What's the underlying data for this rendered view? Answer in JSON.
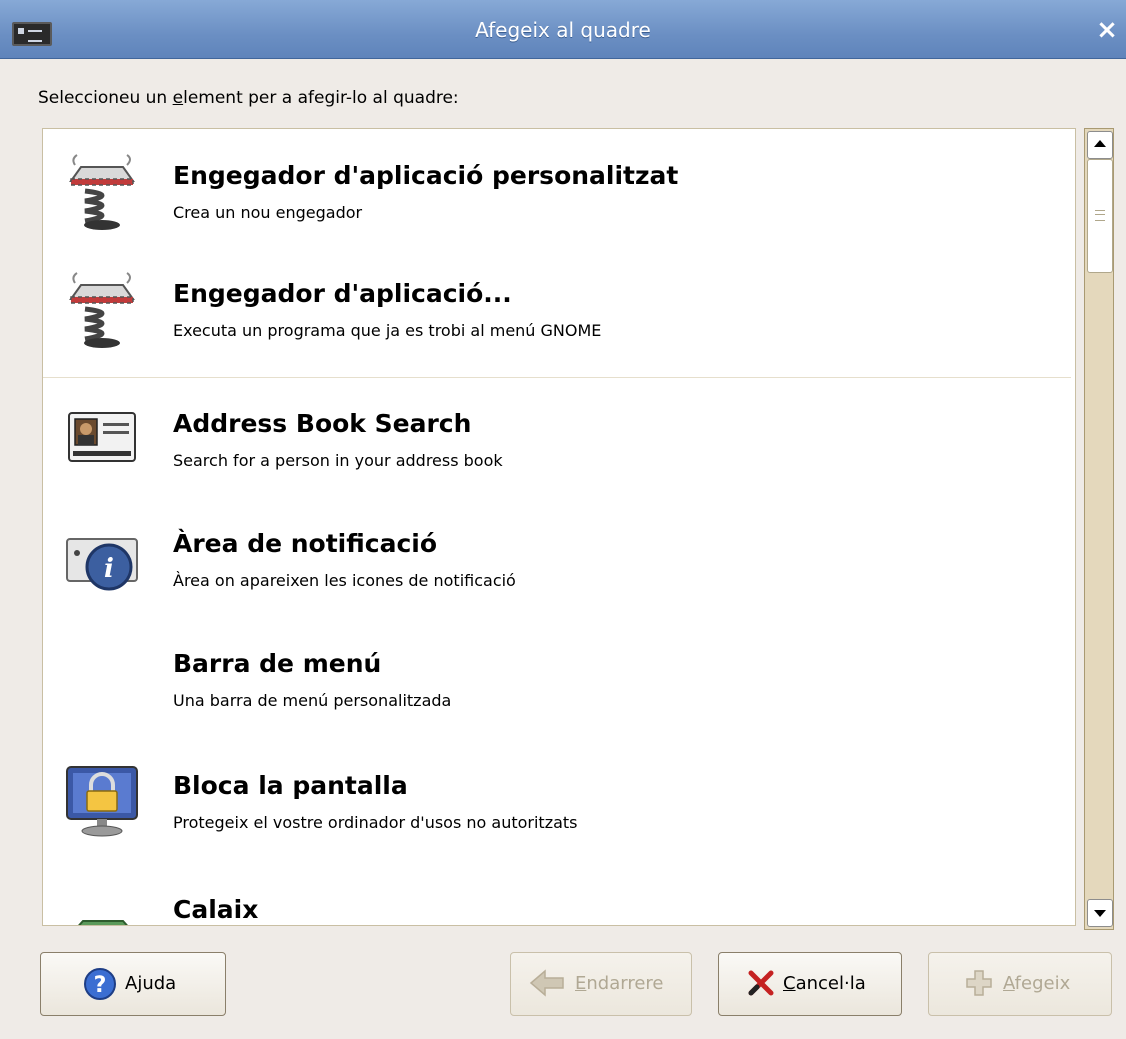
{
  "window": {
    "title": "Afegeix al quadre",
    "close_glyph": "×"
  },
  "prompt": {
    "before": "Seleccioneu un ",
    "mnemonic": "e",
    "after": "lement per a afegir-lo al quadre:"
  },
  "items": [
    {
      "name": "Engegador d'aplicació personalitzat",
      "description": "Crea un nou engegador",
      "icon": "launcher-spring-icon"
    },
    {
      "name": "Engegador d'aplicació...",
      "description": "Executa un programa que ja es trobi al menú GNOME",
      "icon": "launcher-spring-icon"
    },
    {
      "name": "Address Book Search",
      "description": "Search for a person in your address book",
      "icon": "address-card-icon"
    },
    {
      "name": "Àrea de notificació",
      "description": "Àrea on apareixen les icones de notificació",
      "icon": "notification-area-icon"
    },
    {
      "name": "Barra de menú",
      "description": "Una barra de menú personalitzada",
      "icon": ""
    },
    {
      "name": "Bloca la pantalla",
      "description": "Protegeix el vostre ordinador d'usos no autoritzats",
      "icon": "lock-screen-icon"
    },
    {
      "name": "Calaix",
      "description": "",
      "icon": "drawer-icon"
    }
  ],
  "buttons": {
    "help": {
      "before": "A",
      "mnemonic": "j",
      "after": "uda"
    },
    "back": {
      "before": "",
      "mnemonic": "E",
      "after": "ndarrere"
    },
    "cancel": {
      "before": "",
      "mnemonic": "C",
      "after": "ancel·la"
    },
    "add": {
      "before": "",
      "mnemonic": "A",
      "after": "fegeix"
    }
  },
  "colors": {
    "titlebar": "#7398cd",
    "background": "#efebe7",
    "scrollbar_trough": "#e4d8bc"
  }
}
